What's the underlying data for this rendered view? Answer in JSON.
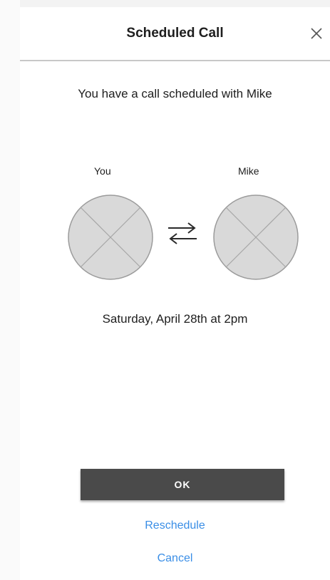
{
  "header": {
    "title": "Scheduled Call"
  },
  "message": "You have a call scheduled with Mike",
  "participants": {
    "you": "You",
    "other": "Mike"
  },
  "datetime": "Saturday, April 28th at 2pm",
  "actions": {
    "ok_label": "OK",
    "reschedule_label": "Reschedule",
    "cancel_label": "Cancel"
  },
  "icons": {
    "close": "close-icon",
    "avatar": "avatar-placeholder-icon",
    "swap": "swap-arrows-icon"
  },
  "colors": {
    "primary_button": "#4a4a4a",
    "link": "#3a8ee6",
    "avatar_fill": "#d9d9d9"
  }
}
